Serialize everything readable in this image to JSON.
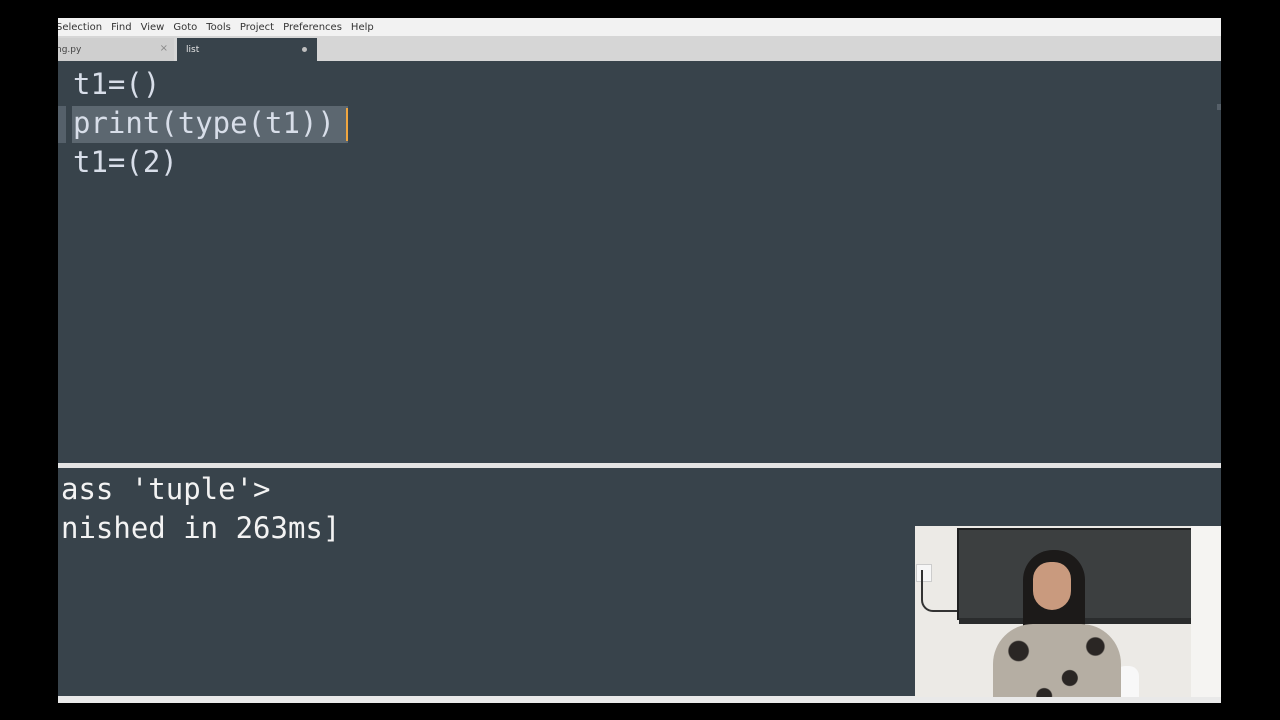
{
  "menu": [
    "Selection",
    "Find",
    "View",
    "Goto",
    "Tools",
    "Project",
    "Preferences",
    "Help"
  ],
  "tabs": [
    {
      "label": "ng.py",
      "close": "×"
    },
    {
      "label": "list"
    }
  ],
  "editor": {
    "lines": [
      "t1=()",
      "print(type(t1))",
      "t1=(2)"
    ]
  },
  "output": {
    "lines": [
      "ass 'tuple'>",
      "nished in 263ms]"
    ]
  },
  "colors": {
    "editor_bg": "#38434b",
    "cursor": "#f0a640",
    "selection": "#5c6770"
  }
}
